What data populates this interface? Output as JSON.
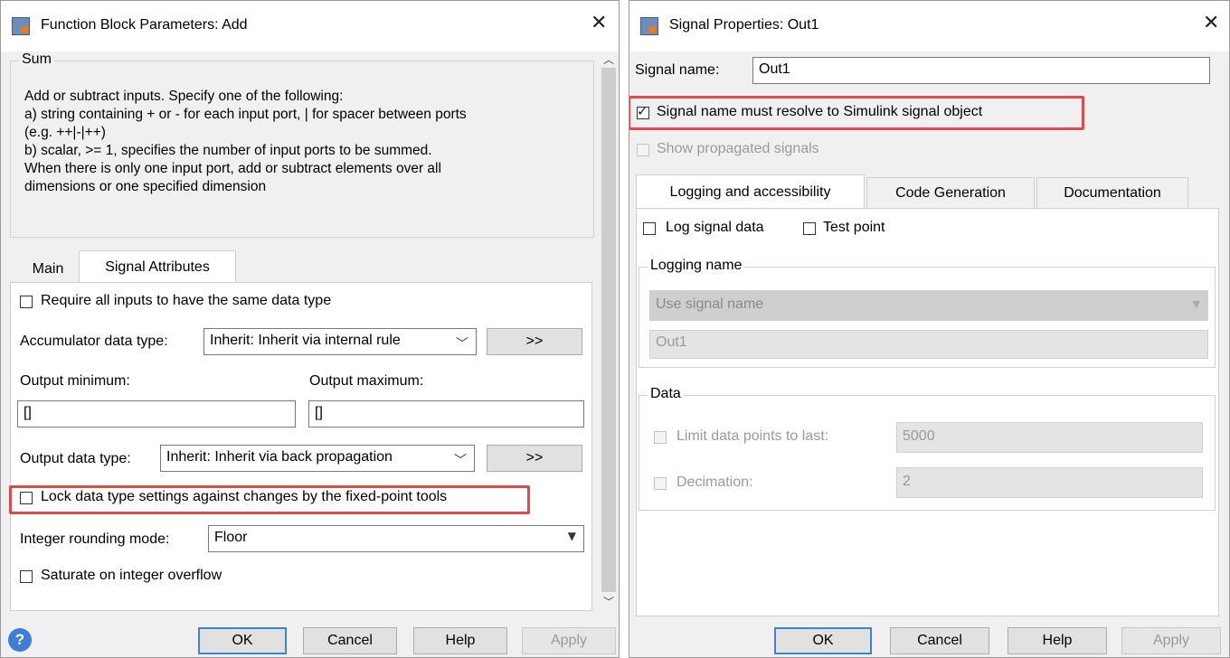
{
  "left": {
    "title": "Function Block Parameters: Add",
    "group_title": "Sum",
    "description": [
      "Add or subtract inputs.  Specify one of the following:",
      "a) string containing + or - for each input port, | for spacer between ports",
      "(e.g. ++|-|++)",
      "b) scalar, >= 1, specifies the number of input ports to be summed.",
      "When there is only one input port, add or subtract elements over all",
      "dimensions or one specified dimension"
    ],
    "tabs": [
      "Main",
      "Signal Attributes"
    ],
    "require_same_type": "Require all inputs to have the same data type",
    "accumulator_label": "Accumulator data type:",
    "accumulator_value": "Inherit: Inherit via internal rule",
    "assistant_btn": ">>",
    "output_min_label": "Output minimum:",
    "output_max_label": "Output maximum:",
    "output_min_value": "[]",
    "output_max_value": "[]",
    "output_type_label": "Output data type:",
    "output_type_value": "Inherit: Inherit via back propagation",
    "lock_label": "Lock data type settings against changes by the fixed-point tools",
    "rounding_label": "Integer rounding mode:",
    "rounding_value": "Floor",
    "saturate_label": "Saturate on integer overflow",
    "buttons": {
      "ok": "OK",
      "cancel": "Cancel",
      "help": "Help",
      "apply": "Apply"
    }
  },
  "right": {
    "title": "Signal Properties: Out1",
    "signal_name_label": "Signal name:",
    "signal_name_value": "Out1",
    "resolve_label": "Signal name must resolve to Simulink signal object",
    "show_propagated": "Show propagated signals",
    "tabs": [
      "Logging and accessibility",
      "Code Generation",
      "Documentation"
    ],
    "log_signal": "Log signal data",
    "test_point": "Test point",
    "logging_name_group": "Logging name",
    "logging_name_select": "Use signal name",
    "logging_name_value": "Out1",
    "data_group": "Data",
    "limit_label": "Limit data points to last:",
    "limit_value": "5000",
    "decimation_label": "Decimation:",
    "decimation_value": "2",
    "buttons": {
      "ok": "OK",
      "cancel": "Cancel",
      "help": "Help",
      "apply": "Apply"
    }
  },
  "colors": {
    "highlight": "#e04a4a",
    "ok_border": "#3c84d6"
  }
}
